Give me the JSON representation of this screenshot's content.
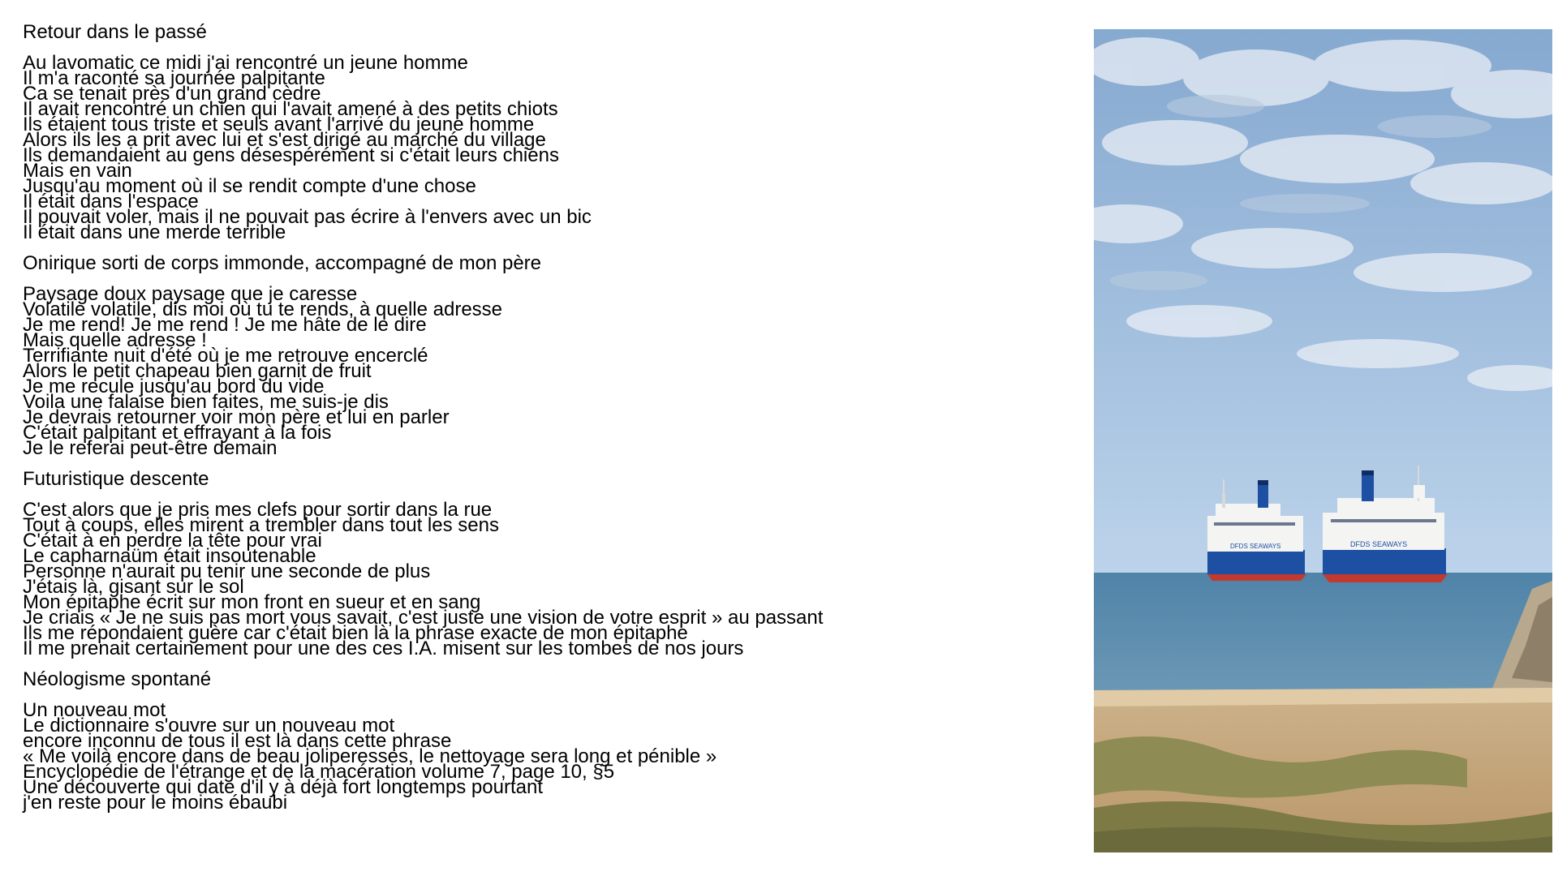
{
  "sections": [
    {
      "title": "Retour dans le passé",
      "lines": [
        "Au lavomatic ce midi j'ai rencontré un jeune homme",
        "Il m'a raconté sa journée palpitante",
        "Ca se tenait près d'un grand cèdre",
        "Il avait rencontré un chien qui l'avait amené à des petits chiots",
        "Ils étaient tous triste et seuls avant l'arrivé du jeune homme",
        "Alors ils les a prit avec lui et s'est dirigé au marché du village",
        "Ils demandaient au gens désespérément si c'était leurs chiens",
        "Mais en vain",
        "Jusqu'au moment où il se rendit compte d'une chose",
        "Il était dans l'espace",
        "Il pouvait voler, mais il ne pouvait pas écrire à l'envers avec un bic",
        "Il était dans une merde terrible"
      ]
    },
    {
      "title": "Onirique sorti de corps immonde, accompagné de mon père",
      "lines": [
        "Paysage doux paysage que je caresse",
        "Volatile volatile, dis moi où tu te rends, à quelle adresse",
        "Je me rend! Je me rend ! Je me hâte de le dire",
        "Mais quelle adresse !",
        "Terrifiante nuit d'été où je me retrouve encerclé",
        "Alors le petit chapeau bien garnit de fruit",
        "Je me recule jusqu'au bord du vide",
        "Voila une falaise bien faites, me suis-je dis",
        "Je devrais retourner voir mon père et lui en parler",
        "C'était palpitant et effrayant à la fois",
        "Je le referai peut-être demain"
      ]
    },
    {
      "title": "Futuristique descente",
      "lines": [
        "C'est alors que je pris mes clefs pour sortir dans la rue",
        "Tout à coups, elles mirent a trembler dans tout les sens",
        "C'était à en perdre la tête pour vrai",
        "Le capharnaüm était insoutenable",
        "Personne n'aurait pu tenir une seconde de plus",
        "J'étais là, gisant sur le sol",
        "Mon épitaphe écrit sur mon front en sueur et en sang",
        "Je criais « Je ne suis pas mort vous savait, c'est juste une vision de votre esprit » au passant",
        "Ils me répondaient guère car c'était bien là la phrase exacte de mon épitaphe",
        "Il me prenait certainement pour une des ces I.A. misent sur les tombes de nos jours"
      ]
    },
    {
      "title": "Néologisme spontané",
      "lines": [
        "Un nouveau mot",
        "Le dictionnaire s'ouvre sur un nouveau mot",
        "encore inconnu de tous il est là dans cette phrase",
        "« Me voilà encore dans de beau joliperesses, le nettoyage sera long et pénible »",
        "Encyclopédie de l'étrange et de la macération volume 7, page 10, §5",
        "Une découverte qui date d'il y à déjà fort longtemps pourtant",
        "j'en reste pour le moins ébaubi"
      ]
    }
  ],
  "photo": {
    "ships": [
      {
        "hull_text": "DFDS SEAWAYS"
      },
      {
        "hull_text": "DFDS SEAWAYS"
      }
    ],
    "colors": {
      "sky_top": "#8fb3d8",
      "sky_bottom": "#c6d9ea",
      "sea": "#5e8fb0",
      "sand": "#c9a77a",
      "hull": "#1d4fa3",
      "superstructure": "#f4f4f2"
    }
  }
}
